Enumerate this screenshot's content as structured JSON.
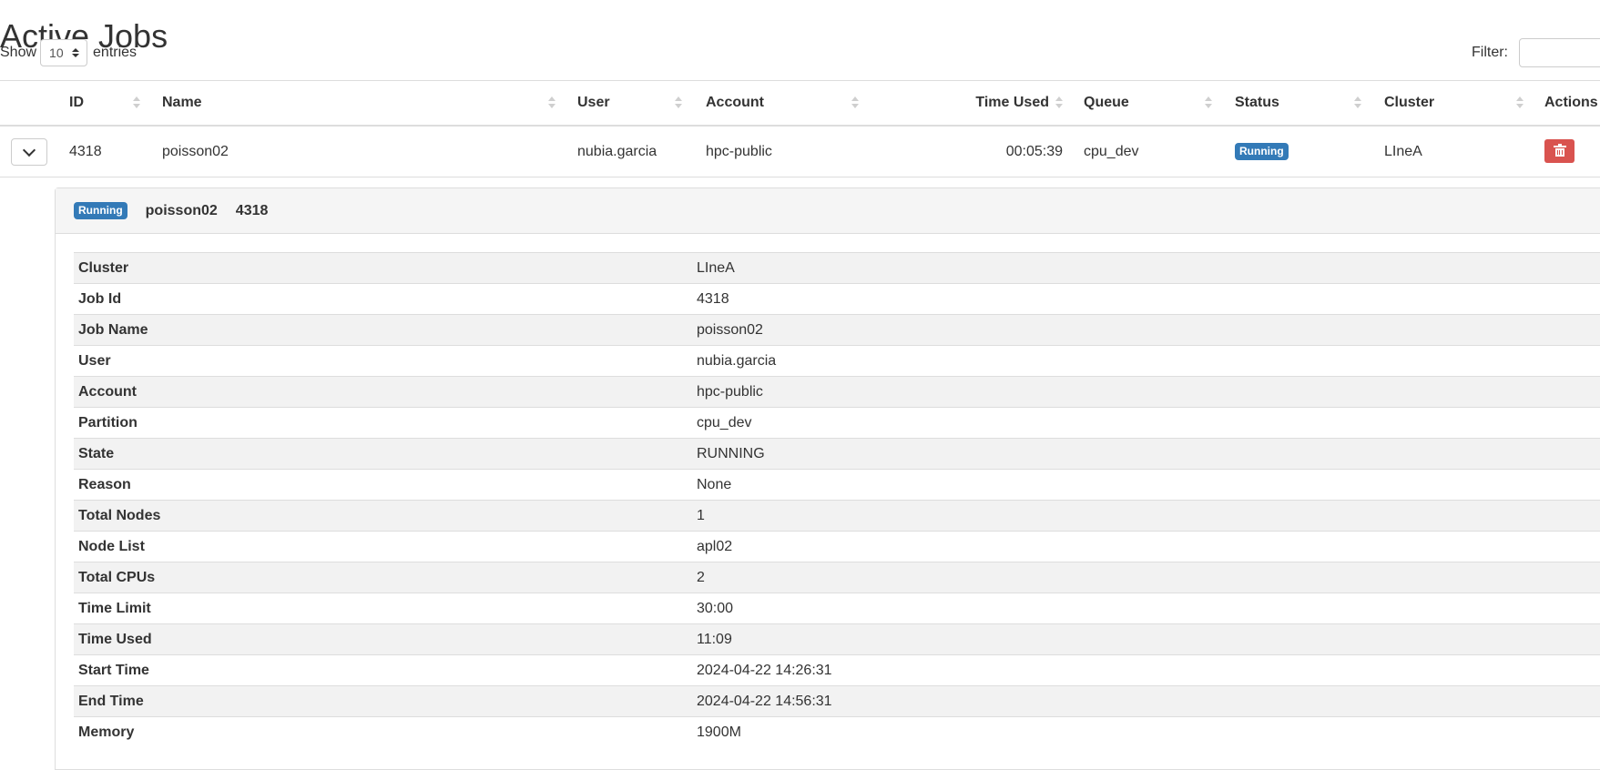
{
  "page": {
    "title": "Active Jobs"
  },
  "controls": {
    "show_label": "Show",
    "entries_value": "10",
    "entries_label": "entries",
    "filter_label": "Filter:",
    "filter_value": ""
  },
  "table": {
    "columns": [
      {
        "label": "ID"
      },
      {
        "label": "Name"
      },
      {
        "label": "User"
      },
      {
        "label": "Account"
      },
      {
        "label": "Time Used"
      },
      {
        "label": "Queue"
      },
      {
        "label": "Status"
      },
      {
        "label": "Cluster"
      },
      {
        "label": "Actions"
      }
    ],
    "rows": [
      {
        "id": "4318",
        "name": "poisson02",
        "user": "nubia.garcia",
        "account": "hpc-public",
        "time_used": "00:05:39",
        "queue": "cpu_dev",
        "status": "Running",
        "cluster": "LIneA"
      }
    ]
  },
  "detail": {
    "badge": "Running",
    "job_name": "poisson02",
    "job_id": "4318",
    "fields": [
      {
        "key": "Cluster",
        "value": "LIneA"
      },
      {
        "key": "Job Id",
        "value": "4318"
      },
      {
        "key": "Job Name",
        "value": "poisson02"
      },
      {
        "key": "User",
        "value": "nubia.garcia"
      },
      {
        "key": "Account",
        "value": "hpc-public"
      },
      {
        "key": "Partition",
        "value": "cpu_dev"
      },
      {
        "key": "State",
        "value": "RUNNING"
      },
      {
        "key": "Reason",
        "value": "None"
      },
      {
        "key": "Total Nodes",
        "value": "1"
      },
      {
        "key": "Node List",
        "value": "apl02"
      },
      {
        "key": "Total CPUs",
        "value": "2"
      },
      {
        "key": "Time Limit",
        "value": "30:00"
      },
      {
        "key": "Time Used",
        "value": "11:09"
      },
      {
        "key": "Start Time",
        "value": "2024-04-22 14:26:31"
      },
      {
        "key": "End Time",
        "value": "2024-04-22 14:56:31"
      },
      {
        "key": "Memory",
        "value": "1900M"
      }
    ]
  },
  "colors": {
    "primary": "#337ab7",
    "danger": "#d9534f",
    "border": "#dddddd",
    "stripe": "#f2f2f2"
  },
  "icons": {
    "expand": "chevron-down-icon",
    "delete": "trash-icon"
  }
}
